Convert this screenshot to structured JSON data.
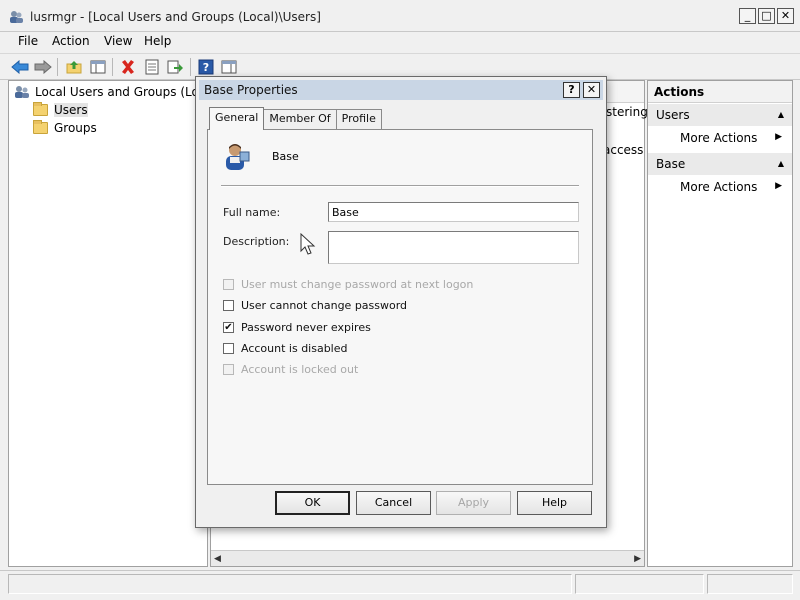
{
  "window": {
    "title": "lusrmgr - [Local Users and Groups (Local)\\Users]",
    "buttons": {
      "minimize": "_",
      "maximize": "□",
      "close": "✕"
    }
  },
  "menu": [
    "File",
    "Action",
    "View",
    "Help"
  ],
  "toolbar_icons": [
    "back-arrow-icon",
    "forward-arrow-icon",
    "up-folder-icon",
    "show-hide-tree-icon",
    "delete-icon",
    "properties-icon",
    "export-icon",
    "help-icon",
    "action-pane-icon"
  ],
  "tree": {
    "root": "Local Users and Groups (Local",
    "children": [
      "Users",
      "Groups"
    ]
  },
  "center": {
    "fragments": [
      "stering",
      "access t"
    ]
  },
  "actions": {
    "title": "Actions",
    "sections": [
      {
        "header": "Users",
        "item": "More Actions"
      },
      {
        "header": "Base",
        "item": "More Actions"
      }
    ]
  },
  "dialog": {
    "title": "Base Properties",
    "title_buttons": {
      "help": "?",
      "close": "✕"
    },
    "tabs": [
      "General",
      "Member Of",
      "Profile"
    ],
    "active_tab": "General",
    "user_name": "Base",
    "full_name_label": "Full name:",
    "full_name_value": "Base",
    "description_label": "Description:",
    "description_value": "",
    "checkboxes": [
      {
        "label": "User must change password at next logon",
        "checked": false,
        "disabled": true
      },
      {
        "label": "User cannot change password",
        "checked": false,
        "disabled": false
      },
      {
        "label": "Password never expires",
        "checked": true,
        "disabled": false
      },
      {
        "label": "Account is disabled",
        "checked": false,
        "disabled": false
      },
      {
        "label": "Account is locked out",
        "checked": false,
        "disabled": true
      }
    ],
    "buttons": {
      "ok": "OK",
      "cancel": "Cancel",
      "apply": "Apply",
      "help": "Help"
    },
    "check_mark": "✔"
  }
}
